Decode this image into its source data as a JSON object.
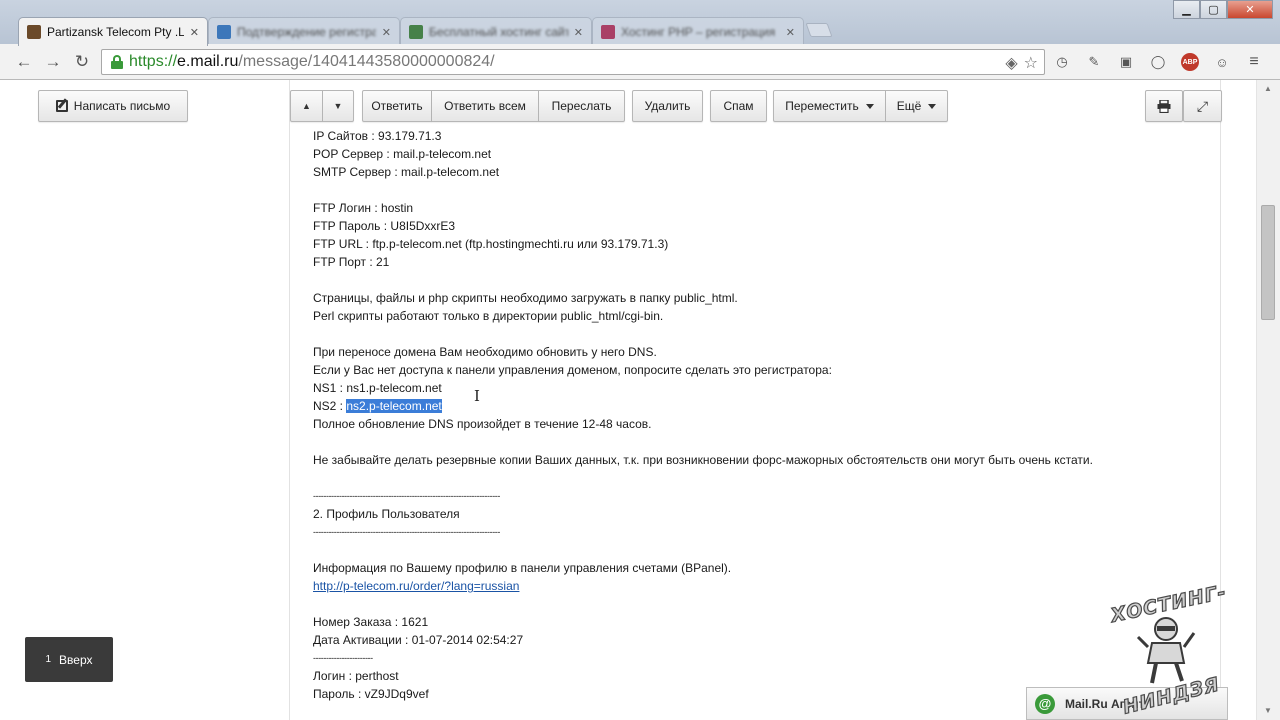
{
  "browser": {
    "active_tab": {
      "title": "Partizansk Telecom Pty .Lt",
      "favicon_color": "#6b4a2a"
    },
    "inactive_tabs": [
      {
        "title": "Подтверждение регистрации",
        "favicon_color": "#2f6fb7"
      },
      {
        "title": "Бесплатный хостинг сайтов",
        "favicon_color": "#3a7a3a"
      },
      {
        "title": "Хостинг PHP – регистрация",
        "favicon_color": "#a8325a"
      }
    ],
    "window_controls": [
      "minimize-icon",
      "maximize-icon",
      "close-icon"
    ],
    "address": {
      "scheme": "https://",
      "host": "e.mail.ru",
      "path": "/message/14041443580000000824/"
    },
    "extensions": [
      "history-icon",
      "evernote-icon",
      "folder-icon",
      "circle-icon",
      "adblock-icon",
      "owl-icon",
      "menu-icon"
    ],
    "extension_labels": {
      "adblock": "ABP"
    }
  },
  "sidebar": {
    "compose_label": "Написать письмо",
    "up_button": {
      "count": "1",
      "label": "Вверх"
    }
  },
  "toolbar": {
    "prev_label": "▲",
    "next_label": "▼",
    "reply_label": "Ответить",
    "reply_all_label": "Ответить всем",
    "forward_label": "Переслать",
    "delete_label": "Удалить",
    "spam_label": "Спам",
    "move_label": "Переместить",
    "more_label": "Ещё",
    "print_icon": "print-icon",
    "expand_icon": "expand-icon"
  },
  "message": {
    "lines": [
      "IP Сайтов : 93.179.71.3",
      "POP Сервер : mail.p-telecom.net",
      "SMTP Сервер : mail.p-telecom.net",
      "",
      "FTP Логин : hostin",
      "FTP Пароль : U8I5DxxrE3",
      "FTP URL : ftp.p-telecom.net (ftp.hostingmechti.ru или 93.179.71.3)",
      "FTP Порт : 21",
      "",
      "Страницы, файлы и php скрипты необходимо загружать в папку public_html.",
      "Perl скрипты работают только в директории public_html/cgi-bin.",
      "",
      "При переносе домена Вам необходимо обновить у него DNS.",
      "Если у Вас нет доступа к панели управления доменом, попросите сделать это регистратора:",
      "NS1 : ns1.p-telecom.net"
    ],
    "ns2_prefix": "NS2 : ",
    "ns2_selected": "ns2.p-telecom.net",
    "lines_after": [
      "Полное обновление DNS произойдет в течение 12-48 часов.",
      "",
      "Не забывайте делать резервные копии Ваших данных, т.к. при возникновении форс-мажорных обстоятельств они могут быть очень кстати.",
      "",
      "------------------------------------------------------------------------",
      "2. Профиль Пользователя",
      "------------------------------------------------------------------------",
      "",
      "Информация по Вашему профилю в панели управления счетами (BPanel)."
    ],
    "link": "http://p-telecom.ru/order/?lang=russian",
    "lines_tail": [
      "",
      "Номер Заказа : 1621",
      "Дата Активации : 01-07-2014 02:54:27",
      "-----------------------",
      "Логин : perthost",
      "Пароль : vZ9JDq9vef"
    ]
  },
  "agent": {
    "label": "Mail.Ru Агент"
  },
  "watermark": {
    "line1": "ХОСТИНГ-",
    "line2": "НИНДЗЯ"
  },
  "colors": {
    "selection": "#3b7dd8",
    "link": "#1a53a5",
    "secure": "#2b8a2b"
  }
}
